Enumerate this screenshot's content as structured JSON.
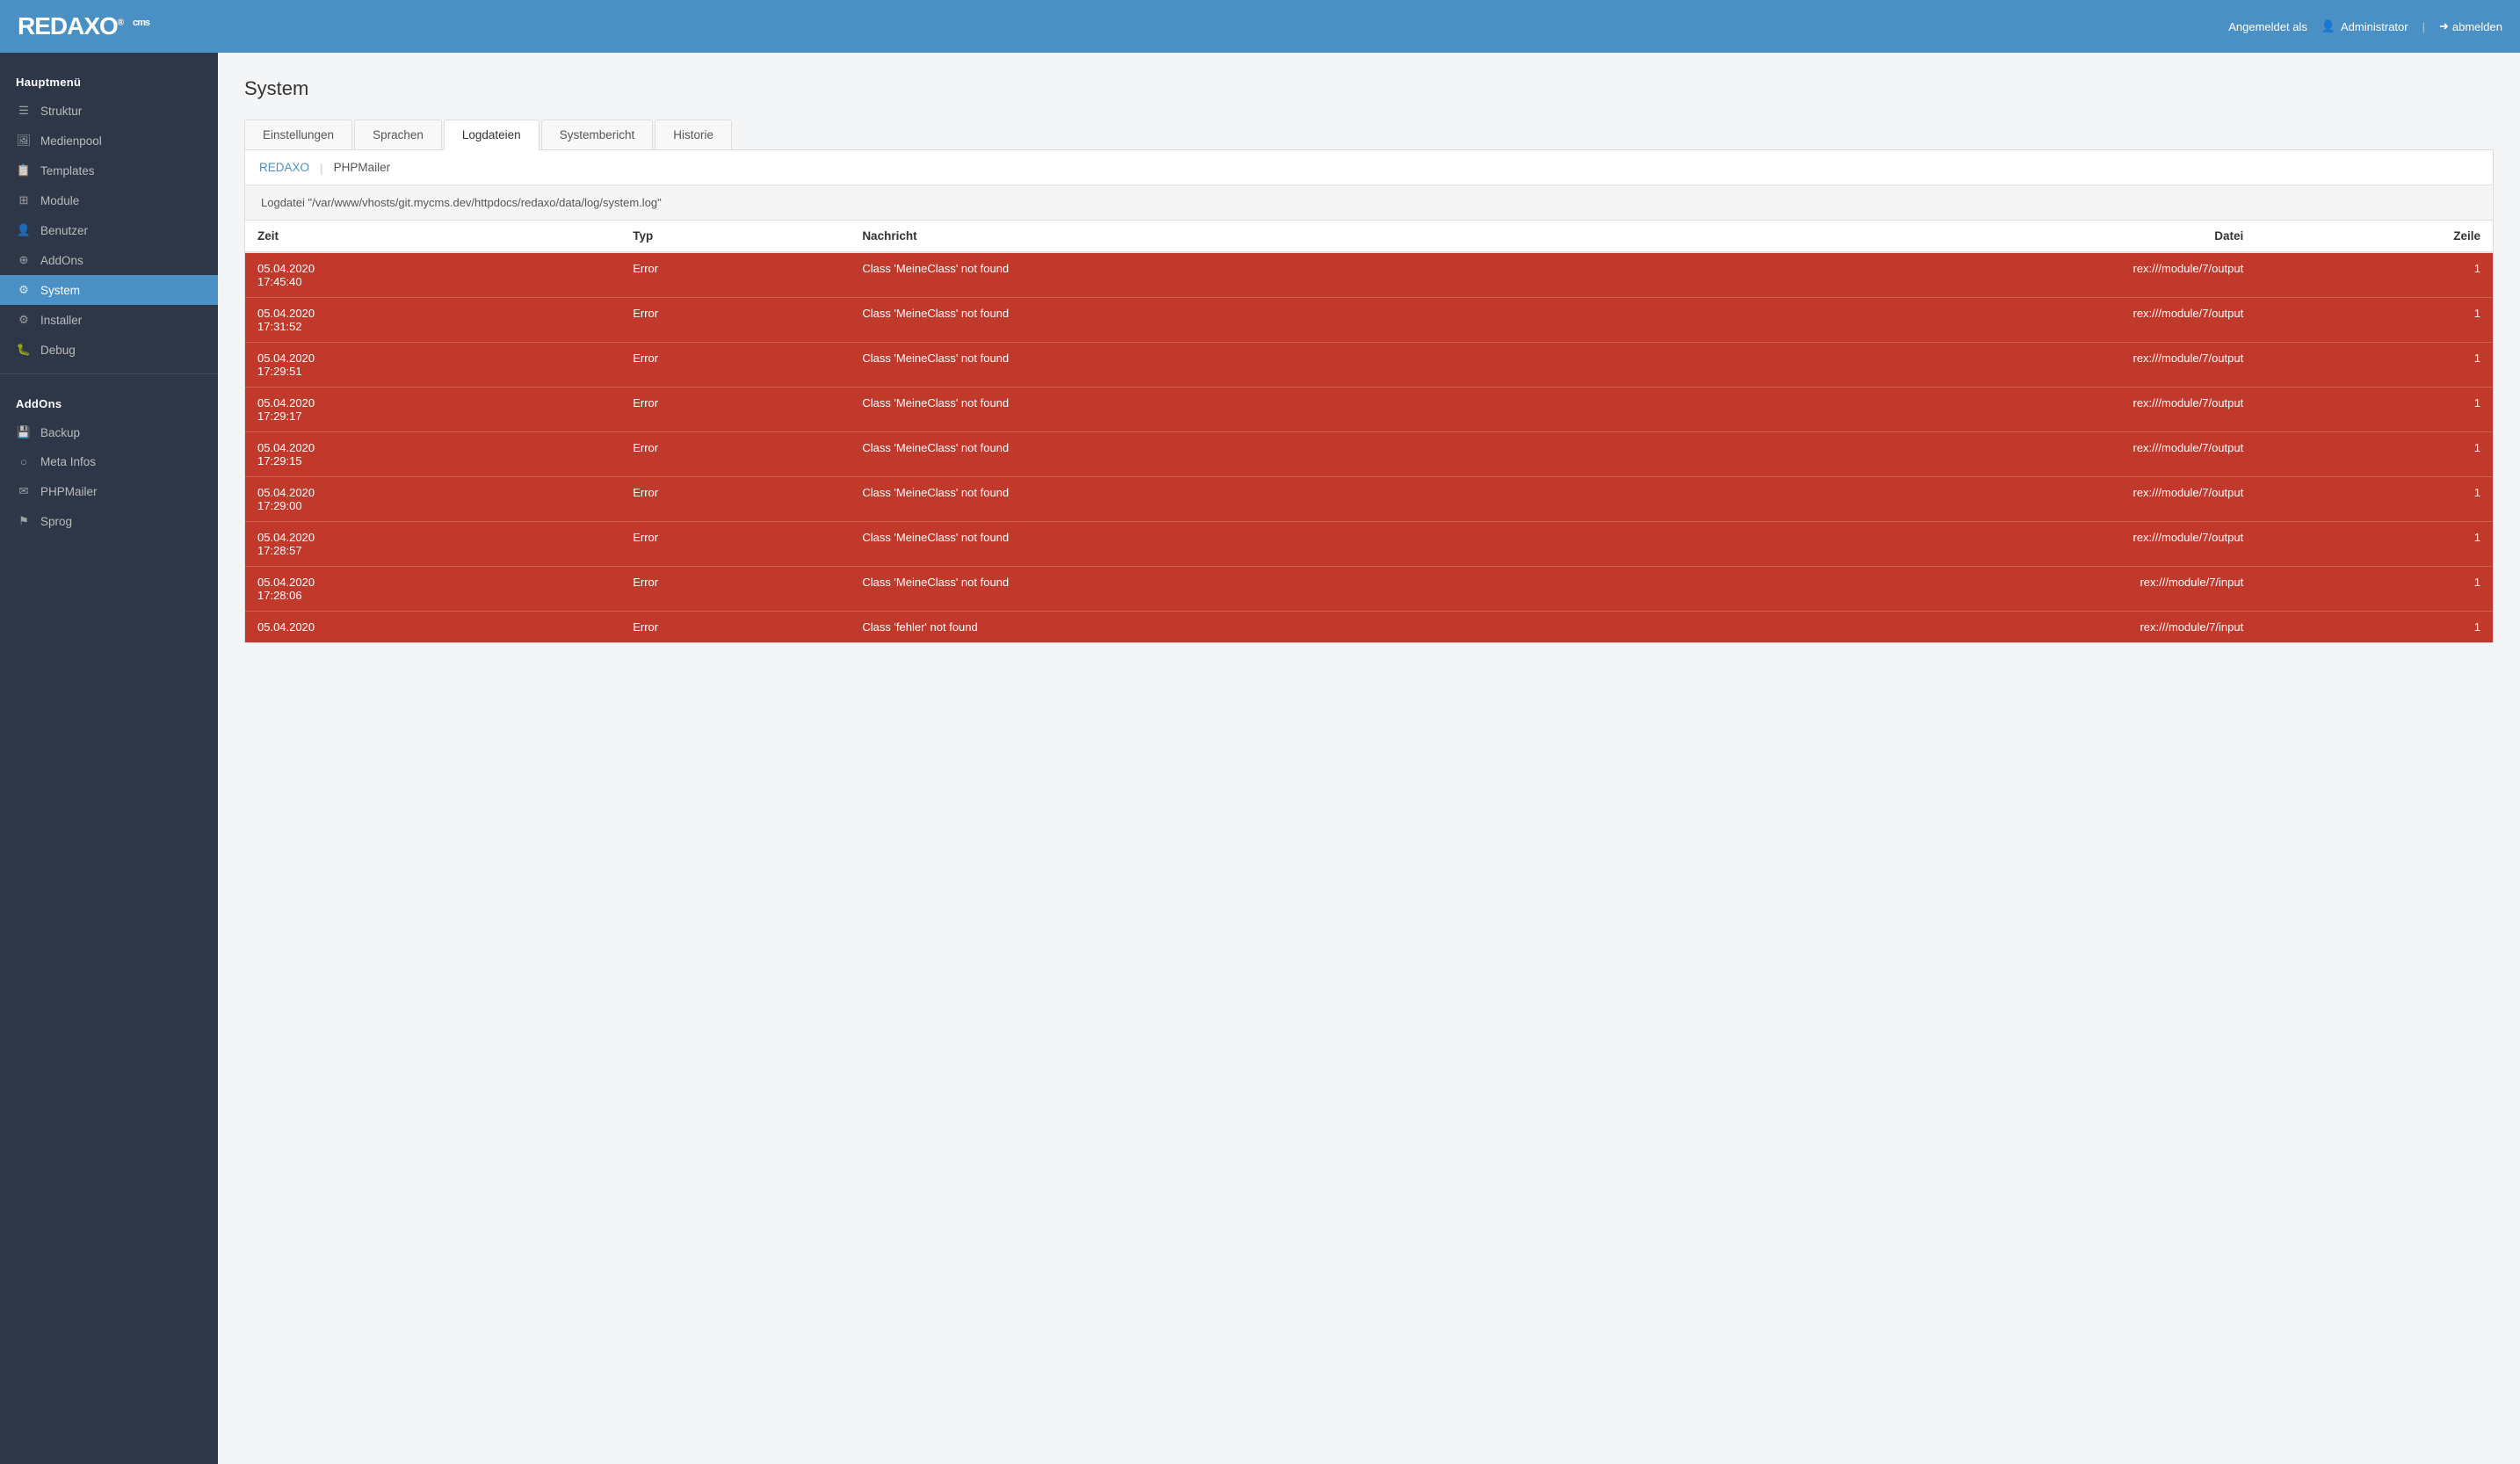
{
  "header": {
    "logo_text": "REDAXO",
    "logo_reg": "®",
    "logo_cms": "cms",
    "logged_in_label": "Angemeldet als",
    "user_icon": "👤",
    "username": "Administrator",
    "logout_icon": "➜",
    "logout_label": "abmelden"
  },
  "sidebar": {
    "main_section": "Hauptmenü",
    "main_items": [
      {
        "id": "struktur",
        "label": "Struktur",
        "icon": "☰"
      },
      {
        "id": "medienpool",
        "label": "Medienpool",
        "icon": "🖼"
      },
      {
        "id": "templates",
        "label": "Templates",
        "icon": "📋"
      },
      {
        "id": "module",
        "label": "Module",
        "icon": "⊞"
      },
      {
        "id": "benutzer",
        "label": "Benutzer",
        "icon": "👤"
      },
      {
        "id": "addons",
        "label": "AddOns",
        "icon": "⊕"
      },
      {
        "id": "system",
        "label": "System",
        "icon": "⚙",
        "active": true
      },
      {
        "id": "installer",
        "label": "Installer",
        "icon": "⚙"
      },
      {
        "id": "debug",
        "label": "Debug",
        "icon": "🐛"
      }
    ],
    "addons_section": "AddOns",
    "addons_items": [
      {
        "id": "backup",
        "label": "Backup",
        "icon": "💾"
      },
      {
        "id": "meta-infos",
        "label": "Meta Infos",
        "icon": "○"
      },
      {
        "id": "phpmailer",
        "label": "PHPMailer",
        "icon": "✉"
      },
      {
        "id": "sprog",
        "label": "Sprog",
        "icon": "⚑"
      }
    ]
  },
  "page": {
    "title": "System"
  },
  "tabs": [
    {
      "id": "einstellungen",
      "label": "Einstellungen"
    },
    {
      "id": "sprachen",
      "label": "Sprachen"
    },
    {
      "id": "logdateien",
      "label": "Logdateien",
      "active": true
    },
    {
      "id": "systembericht",
      "label": "Systembericht"
    },
    {
      "id": "historie",
      "label": "Historie"
    }
  ],
  "sub_tabs": [
    {
      "id": "redaxo",
      "label": "REDAXO",
      "active": true
    },
    {
      "id": "phpmailer",
      "label": "PHPMailer"
    }
  ],
  "log_path": "Logdatei \"/var/www/vhosts/git.mycms.dev/httpdocs/redaxo/data/log/system.log\"",
  "table_headers": {
    "zeit": "Zeit",
    "typ": "Typ",
    "nachricht": "Nachricht",
    "datei": "Datei",
    "zeile": "Zeile"
  },
  "log_rows": [
    {
      "zeit": "05.04.2020\n17:45:40",
      "typ": "Error",
      "nachricht": "Class 'MeineClass' not found",
      "datei": "rex:///module/7/output",
      "zeile": "1"
    },
    {
      "zeit": "05.04.2020\n17:31:52",
      "typ": "Error",
      "nachricht": "Class 'MeineClass' not found",
      "datei": "rex:///module/7/output",
      "zeile": "1"
    },
    {
      "zeit": "05.04.2020\n17:29:51",
      "typ": "Error",
      "nachricht": "Class 'MeineClass' not found",
      "datei": "rex:///module/7/output",
      "zeile": "1"
    },
    {
      "zeit": "05.04.2020\n17:29:17",
      "typ": "Error",
      "nachricht": "Class 'MeineClass' not found",
      "datei": "rex:///module/7/output",
      "zeile": "1"
    },
    {
      "zeit": "05.04.2020\n17:29:15",
      "typ": "Error",
      "nachricht": "Class 'MeineClass' not found",
      "datei": "rex:///module/7/output",
      "zeile": "1"
    },
    {
      "zeit": "05.04.2020\n17:29:00",
      "typ": "Error",
      "nachricht": "Class 'MeineClass' not found",
      "datei": "rex:///module/7/output",
      "zeile": "1"
    },
    {
      "zeit": "05.04.2020\n17:28:57",
      "typ": "Error",
      "nachricht": "Class 'MeineClass' not found",
      "datei": "rex:///module/7/output",
      "zeile": "1"
    },
    {
      "zeit": "05.04.2020\n17:28:06",
      "typ": "Error",
      "nachricht": "Class 'MeineClass' not found",
      "datei": "rex:///module/7/input",
      "zeile": "1"
    },
    {
      "zeit": "05.04.2020",
      "typ": "Error",
      "nachricht": "Class 'fehler' not found",
      "datei": "rex:///module/7/input",
      "zeile": "1"
    }
  ]
}
